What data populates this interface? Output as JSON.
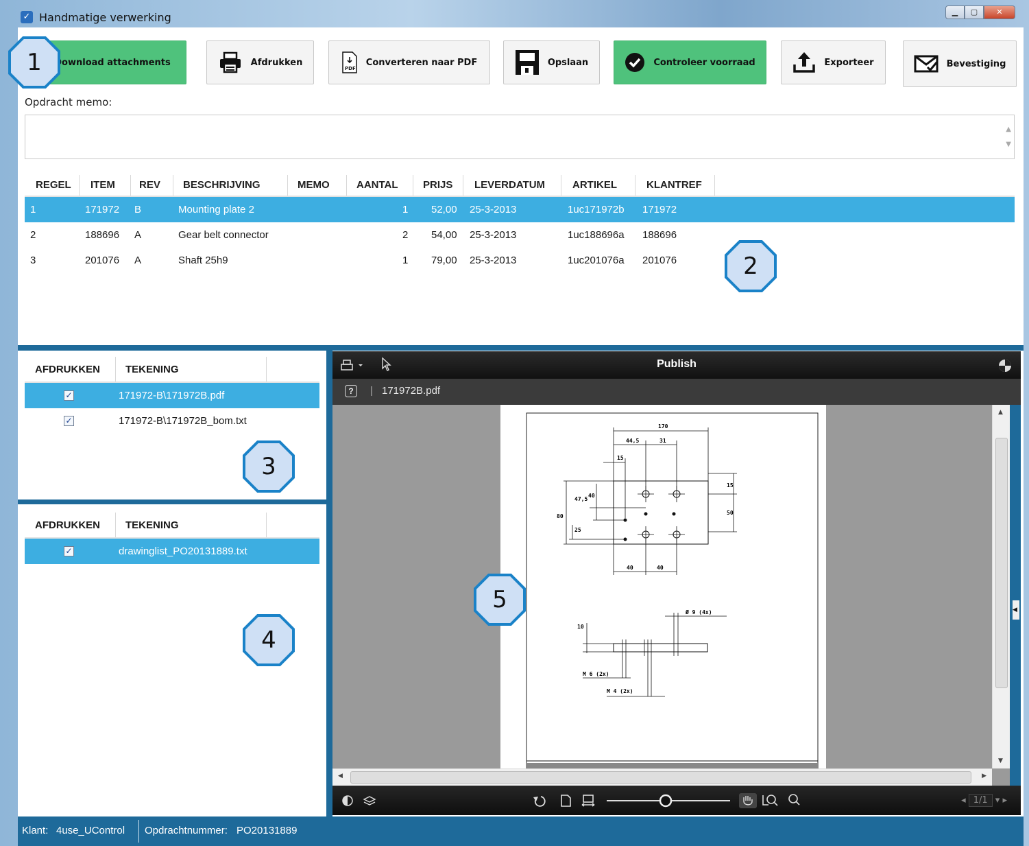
{
  "window": {
    "title": "Handmatige verwerking"
  },
  "toolbar": {
    "download": "Download attachments",
    "print": "Afdrukken",
    "convert": "Converteren naar PDF",
    "save": "Opslaan",
    "check_stock": "Controleer voorraad",
    "export": "Exporteer",
    "confirm": "Bevestiging"
  },
  "memo": {
    "label": "Opdracht memo:",
    "value": ""
  },
  "order_table": {
    "columns": [
      "REGEL",
      "ITEM",
      "REV",
      "BESCHRIJVING",
      "MEMO",
      "AANTAL",
      "PRIJS",
      "LEVERDATUM",
      "ARTIKEL",
      "KLANTREF"
    ],
    "rows": [
      {
        "regel": "1",
        "item": "171972",
        "rev": "B",
        "beschrijving": "Mounting plate 2",
        "memo": "",
        "aantal": "1",
        "prijs": "52,00",
        "leverdatum": "25-3-2013",
        "artikel": "1uc171972b",
        "klantref": "171972",
        "selected": true
      },
      {
        "regel": "2",
        "item": "188696",
        "rev": "A",
        "beschrijving": "Gear belt connector",
        "memo": "",
        "aantal": "2",
        "prijs": "54,00",
        "leverdatum": "25-3-2013",
        "artikel": "1uc188696a",
        "klantref": "188696",
        "selected": false
      },
      {
        "regel": "3",
        "item": "201076",
        "rev": "A",
        "beschrijving": "Shaft 25h9",
        "memo": "",
        "aantal": "1",
        "prijs": "79,00",
        "leverdatum": "25-3-2013",
        "artikel": "1uc201076a",
        "klantref": "201076",
        "selected": false
      }
    ]
  },
  "drawings_list": {
    "columns": [
      "AFDRUKKEN",
      "TEKENING"
    ],
    "rows": [
      {
        "file": "171972-B\\171972B.pdf",
        "checked": true,
        "selected": true
      },
      {
        "file": "171972-B\\171972B_bom.txt",
        "checked": true,
        "selected": false
      }
    ]
  },
  "order_files_list": {
    "columns": [
      "AFDRUKKEN",
      "TEKENING"
    ],
    "rows": [
      {
        "file": "drawinglist_PO20131889.txt",
        "checked": true,
        "selected": true
      }
    ]
  },
  "viewer": {
    "title": "Publish",
    "help": "?",
    "filename": "171972B.pdf",
    "page_indicator": "1/1",
    "drawing_dims": {
      "top_width": "170",
      "d1": "44,5",
      "d2": "31",
      "d3": "15",
      "left_height": "80",
      "v1": "47,5",
      "v2": "40",
      "v3": "25",
      "right_v1": "15",
      "right_v2": "50",
      "bottom_1": "40",
      "bottom_2": "40",
      "hole_note": "Ø 9 (4x)",
      "side_h": "10",
      "thread1": "M 6 (2x)",
      "thread2": "M 4 (2x)"
    }
  },
  "status": {
    "klant_label": "Klant:",
    "klant_value": "4use_UControl",
    "order_label": "Opdrachtnummer:",
    "order_value": "PO20131889"
  },
  "callouts": [
    "1",
    "2",
    "3",
    "4",
    "5"
  ],
  "colors": {
    "accent_blue": "#1e6a9a",
    "selection": "#3daee1",
    "green_button": "#4fc27c",
    "callout_fill": "#cfe0f5",
    "callout_border": "#1a82c8"
  }
}
